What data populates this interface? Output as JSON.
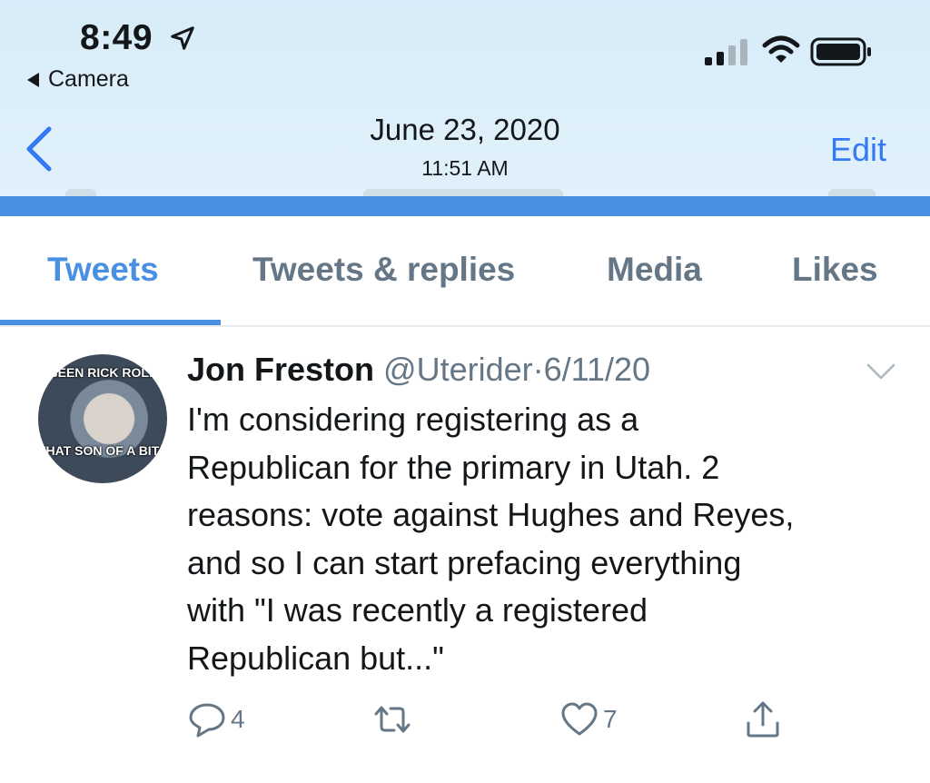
{
  "status_bar": {
    "time": "8:49",
    "back_app": "Camera",
    "icons": [
      "location-arrow-icon",
      "cellular-signal-icon",
      "wifi-icon",
      "battery-icon"
    ]
  },
  "photo_header": {
    "date": "June 23, 2020",
    "time": "11:51 AM",
    "edit_label": "Edit"
  },
  "tabs": [
    {
      "label": "Tweets",
      "active": true
    },
    {
      "label": "Tweets & replies",
      "active": false
    },
    {
      "label": "Media",
      "active": false
    },
    {
      "label": "Likes",
      "active": false
    }
  ],
  "tweet": {
    "avatar_caption_top": "BEEN RICK ROLL",
    "avatar_caption_bottom": "THAT SON OF A BITCH",
    "name": "Jon Freston",
    "handle": "@Uterider",
    "separator": "·",
    "date": "6/11/20",
    "text_lines": [
      "I'm considering registering as a",
      "Republican for the primary in Utah. 2",
      "reasons: vote against Hughes and Reyes,",
      "and so I can start prefacing everything",
      "with \"I was recently a registered",
      "Republican but...\""
    ],
    "replies": "4",
    "retweets": "",
    "likes": "7"
  },
  "colors": {
    "accent": "#4a90e2",
    "ios_blue": "#3478f6",
    "muted": "#657786",
    "header_bg": "#dcefFa"
  }
}
